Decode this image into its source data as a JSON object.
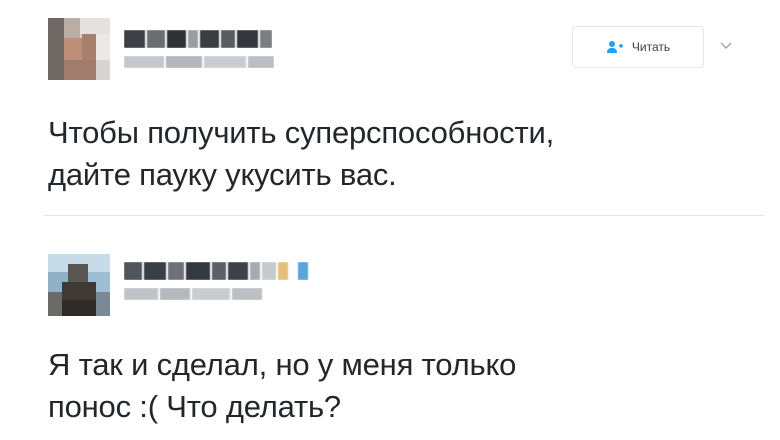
{
  "tweets": [
    {
      "follow_label": "Читать",
      "text_lines": [
        "Чтобы получить суперспособности,",
        "дайте пауку укусить вас."
      ]
    },
    {
      "text_lines": [
        "Я так и сделал, но у меня только",
        "понос :( Что делать?"
      ]
    }
  ],
  "icons": {
    "follow": "person-plus-icon",
    "menu": "chevron-down-icon"
  },
  "colors": {
    "follow_icon": "#1da1f2",
    "text": "#22272b",
    "divider": "#e3e6e8"
  }
}
